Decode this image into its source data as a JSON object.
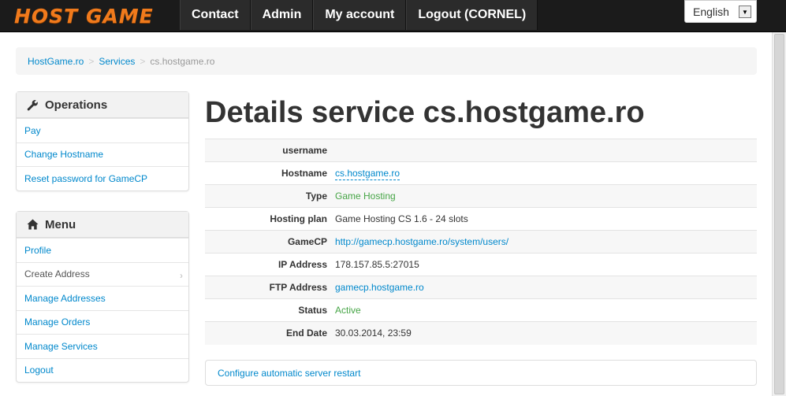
{
  "header": {
    "logo_text": "HOST GAME",
    "nav": [
      "Contact",
      "Admin",
      "My account",
      "Logout (CORNEL)"
    ],
    "language": "English"
  },
  "breadcrumb": [
    "HostGame.ro",
    "Services",
    "cs.hostgame.ro"
  ],
  "operations": {
    "title": "Operations",
    "items": [
      "Pay",
      "Change Hostname",
      "Reset password for GameCP"
    ]
  },
  "menu": {
    "title": "Menu",
    "items": [
      "Profile",
      "Create Address",
      "Manage Addresses",
      "Manage Orders",
      "Manage Services",
      "Logout"
    ]
  },
  "main": {
    "title": "Details service cs.hostgame.ro",
    "details": [
      {
        "label": "username",
        "value": ""
      },
      {
        "label": "Hostname",
        "value": "cs.hostgame.ro"
      },
      {
        "label": "Type",
        "value": "Game Hosting"
      },
      {
        "label": "Hosting plan",
        "value": "Game Hosting CS 1.6 - 24 slots"
      },
      {
        "label": "GameCP",
        "value": "http://gamecp.hostgame.ro/system/users/"
      },
      {
        "label": "IP Address",
        "value": "178.157.85.5:27015"
      },
      {
        "label": "FTP Address",
        "value": "gamecp.hostgame.ro"
      },
      {
        "label": "Status",
        "value": "Active"
      },
      {
        "label": "End Date",
        "value": "30.03.2014, 23:59"
      }
    ],
    "restart_link": "Configure automatic server restart"
  },
  "colors": {
    "link": "#0088cc",
    "green": "#46a546",
    "logo_orange": "#f07a1c",
    "topbar": "#1b1b1b"
  }
}
